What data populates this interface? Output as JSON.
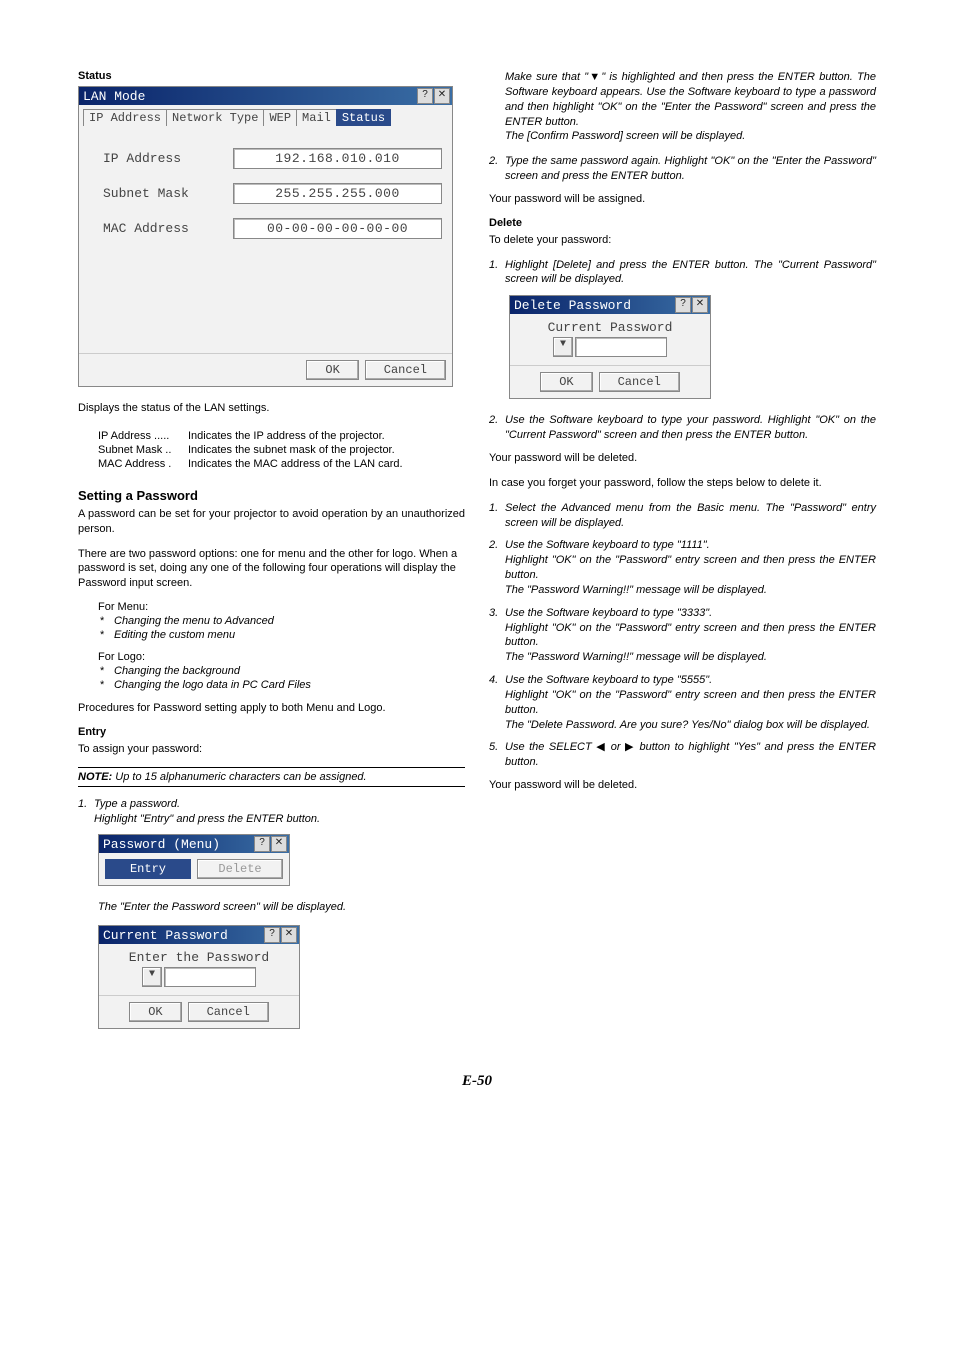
{
  "left": {
    "status_heading": "Status",
    "lan_dialog": {
      "title": "LAN Mode",
      "tabs": [
        "IP Address",
        "Network Type",
        "WEP",
        "Mail",
        "Status"
      ],
      "rows": {
        "ip_label": "IP Address",
        "ip_value": "192.168.010.010",
        "subnet_label": "Subnet Mask",
        "subnet_value": "255.255.255.000",
        "mac_label": "MAC Address",
        "mac_value": "00-00-00-00-00-00"
      },
      "ok": "OK",
      "cancel": "Cancel"
    },
    "status_desc": "Displays the status of the LAN settings.",
    "defs": {
      "ip_k": "IP Address .....",
      "ip_v": "Indicates the IP address of the projector.",
      "sn_k": "Subnet Mask ..",
      "sn_v": "Indicates the subnet mask of the projector.",
      "mac_k": "MAC Address .",
      "mac_v": "Indicates the MAC address of the LAN card."
    },
    "pw_heading": "Setting a Password",
    "pw_p1": "A password can be set for your projector to avoid operation by an unauthorized person.",
    "pw_p2": "There are two password options: one for menu and the other for logo. When a password is set, doing any one of the following four operations will display the Password input screen.",
    "for_menu": "For Menu:",
    "menu_b1": "Changing the menu to Advanced",
    "menu_b2": "Editing the custom menu",
    "for_logo": "For Logo:",
    "logo_b1": "Changing the background",
    "logo_b2": "Changing the logo data in PC Card Files",
    "pw_p3": "Procedures for Password setting apply to both Menu and Logo.",
    "entry_h": "Entry",
    "entry_sub": "To assign your password:",
    "note_label": "NOTE:",
    "note_text": " Up to 15 alphanumeric characters can be assigned.",
    "step1_num": "1.",
    "step1_a": "Type a password.",
    "step1_b": "Highlight \"Entry\" and press the ENTER button.",
    "pw_menu_dialog": {
      "title": "Password (Menu)",
      "entry": "Entry",
      "delete": "Delete"
    },
    "step1_after": "The \"Enter the Password screen\" will be displayed.",
    "cur_pw_dialog": {
      "title": "Current Password",
      "label": "Enter the Password",
      "ok": "OK",
      "cancel": "Cancel"
    }
  },
  "right": {
    "top1": "Make sure that \"▼\" is highlighted and then press the ENTER button. The Software keyboard appears. Use the Software keyboard to type a password and then highlight \"OK\" on the \"Enter the Password\" screen and press the ENTER button.",
    "top2": "The [Confirm Password] screen will be displayed.",
    "step2_num": "2.",
    "step2": "Type the same password again. Highlight \"OK\" on the \"Enter the Password\" screen and press the ENTER button.",
    "assigned": "Your password will be assigned.",
    "del_h": "Delete",
    "del_sub": "To delete your password:",
    "dstep1_num": "1.",
    "dstep1": "Highlight [Delete] and press the ENTER button. The \"Current Password\" screen will be displayed.",
    "del_dialog": {
      "title": "Delete Password",
      "label": "Current Password",
      "ok": "OK",
      "cancel": "Cancel"
    },
    "dstep2_num": "2.",
    "dstep2": "Use the Software keyboard to type your password. Highlight \"OK\" on the \"Current Password\" screen and then press the ENTER button.",
    "deleted": "Your password will be deleted.",
    "forgot": "In case you forget your password, follow the steps below to delete it.",
    "f1_num": "1.",
    "f1": "Select the Advanced menu from the Basic menu. The \"Password\" entry screen will be displayed.",
    "f2_num": "2.",
    "f2a": "Use the Software keyboard to type \"1111\".",
    "f2b": "Highlight \"OK\" on the \"Password\" entry screen and then press the ENTER button.",
    "f2c": "The \"Password Warning!!\" message will be displayed.",
    "f3_num": "3.",
    "f3a": "Use the Software keyboard to type \"3333\".",
    "f3b": "Highlight \"OK\" on the \"Password\" entry screen and then press the ENTER button.",
    "f3c": "The \"Password Warning!!\" message will be displayed.",
    "f4_num": "4.",
    "f4a": "Use the Software keyboard to type \"5555\".",
    "f4b": "Highlight \"OK\" on the \"Password\" entry screen and then press the ENTER button.",
    "f4c": "The \"Delete Password. Are you sure? Yes/No\" dialog box will be displayed.",
    "f5_num": "5.",
    "f5a_pre": "Use the SELECT ",
    "f5a_mid": " or ",
    "f5a_post": " button to highlight \"Yes\" and press the ENTER button.",
    "deleted2": "Your password will be deleted."
  },
  "glyphs": {
    "left_tri": "◀",
    "right_tri": "▶",
    "down_tri": "▼",
    "help": "?",
    "close": "✕"
  },
  "page_num": "E-50"
}
